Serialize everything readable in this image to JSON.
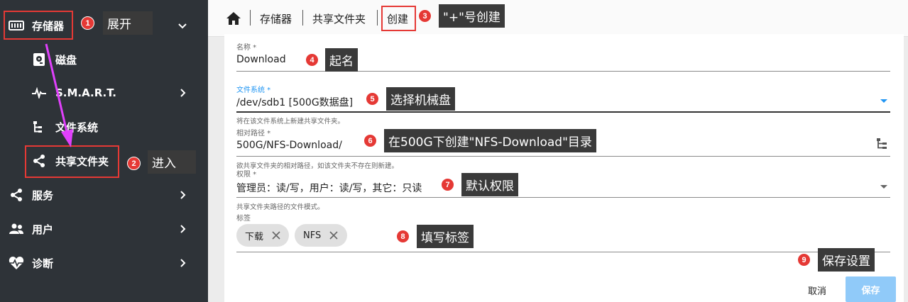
{
  "sidebar": {
    "items": [
      {
        "label": "存储器"
      },
      {
        "label": "磁盘"
      },
      {
        "label": "S.M.A.R.T."
      },
      {
        "label": "文件系统"
      },
      {
        "label": "共享文件夹"
      },
      {
        "label": "服务"
      },
      {
        "label": "用户"
      },
      {
        "label": "诊断"
      }
    ]
  },
  "breadcrumb": {
    "items": [
      "存储器",
      "共享文件夹",
      "创建"
    ]
  },
  "form": {
    "name": {
      "label": "名称 *",
      "value": "Download"
    },
    "filesystem": {
      "label": "文件系统 *",
      "value": "/dev/sdb1 [500G数据盘]",
      "hint": "将在该文件系统上新建共享文件夹。"
    },
    "path": {
      "label": "相对路径 *",
      "value": "500G/NFS-Download/",
      "hint": "欲共享文件夹的相对路径，如该文件夹不存在则新建。"
    },
    "permissions": {
      "label": "权限 *",
      "value": "管理员：读/写，用户：读/写，其它：只读",
      "hint": "共享文件夹路径的文件模式。"
    },
    "tags": {
      "label": "标签",
      "chips": [
        "下载",
        "NFS"
      ]
    }
  },
  "actions": {
    "cancel": "取消",
    "save": "保存"
  },
  "annotations": {
    "badges": [
      "1",
      "2",
      "3",
      "4",
      "5",
      "6",
      "7",
      "8",
      "9"
    ],
    "notes": [
      "展开",
      "进入",
      "\"+\"号创建",
      "起名",
      "选择机械盘",
      "在500G下创建\"NFS-Download\"目录",
      "默认权限",
      "填写标签",
      "保存设置"
    ]
  },
  "colors": {
    "sidebar_bg": "#2e3338",
    "accent": "#2196f3",
    "annotation_red": "#e53935",
    "annotation_bg": "#3a3a3a",
    "save_button": "#90caf9",
    "arrow": "#e040fb"
  }
}
